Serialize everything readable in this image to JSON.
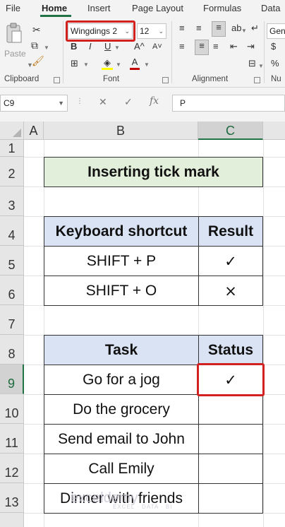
{
  "menu": {
    "tabs": [
      "File",
      "Home",
      "Insert",
      "Page Layout",
      "Formulas",
      "Data"
    ],
    "active": "Home"
  },
  "ribbon": {
    "clipboard": {
      "paste_label": "Paste",
      "group_label": "Clipboard"
    },
    "font": {
      "font_name": "Wingdings 2",
      "font_size": "12",
      "bold": "B",
      "italic": "I",
      "underline": "U",
      "grow": "A^",
      "shrink": "A˅",
      "fill_color": "#FFFF00",
      "font_color": "#C00000",
      "font_color_letter": "A",
      "group_label": "Font"
    },
    "alignment": {
      "group_label": "Alignment"
    },
    "number": {
      "format": "Gene",
      "currency": "$",
      "percent": "%",
      "group_label": "Nu"
    }
  },
  "formula_bar": {
    "name_box": "C9",
    "fx": "fx",
    "formula": "P"
  },
  "sheet": {
    "columns": [
      "A",
      "B",
      "C"
    ],
    "selected_column": "C",
    "rows": [
      "1",
      "2",
      "3",
      "4",
      "5",
      "6",
      "7",
      "8",
      "9",
      "10",
      "11",
      "12",
      "13"
    ],
    "selected_row": "9",
    "title": "Inserting tick mark",
    "table1": {
      "headers": [
        "Keyboard shortcut",
        "Result"
      ],
      "rows": [
        {
          "shortcut": "SHIFT + P",
          "result": "✓"
        },
        {
          "shortcut": "SHIFT + O",
          "result": "×"
        }
      ]
    },
    "table2": {
      "headers": [
        "Task",
        "Status"
      ],
      "rows": [
        {
          "task": "Go for a jog",
          "status": "✓"
        },
        {
          "task": "Do the grocery",
          "status": ""
        },
        {
          "task": "Send email to John",
          "status": ""
        },
        {
          "task": "Call Emily",
          "status": ""
        },
        {
          "task": "Dinner with friends",
          "status": ""
        }
      ]
    },
    "watermark": {
      "brand": "exceldemy",
      "tagline": "EXCEL · DATA · BI"
    }
  },
  "colors": {
    "accent": "#217346",
    "highlight": "#D32020",
    "title_fill": "#E2EFDA",
    "header_fill": "#DAE3F3"
  }
}
